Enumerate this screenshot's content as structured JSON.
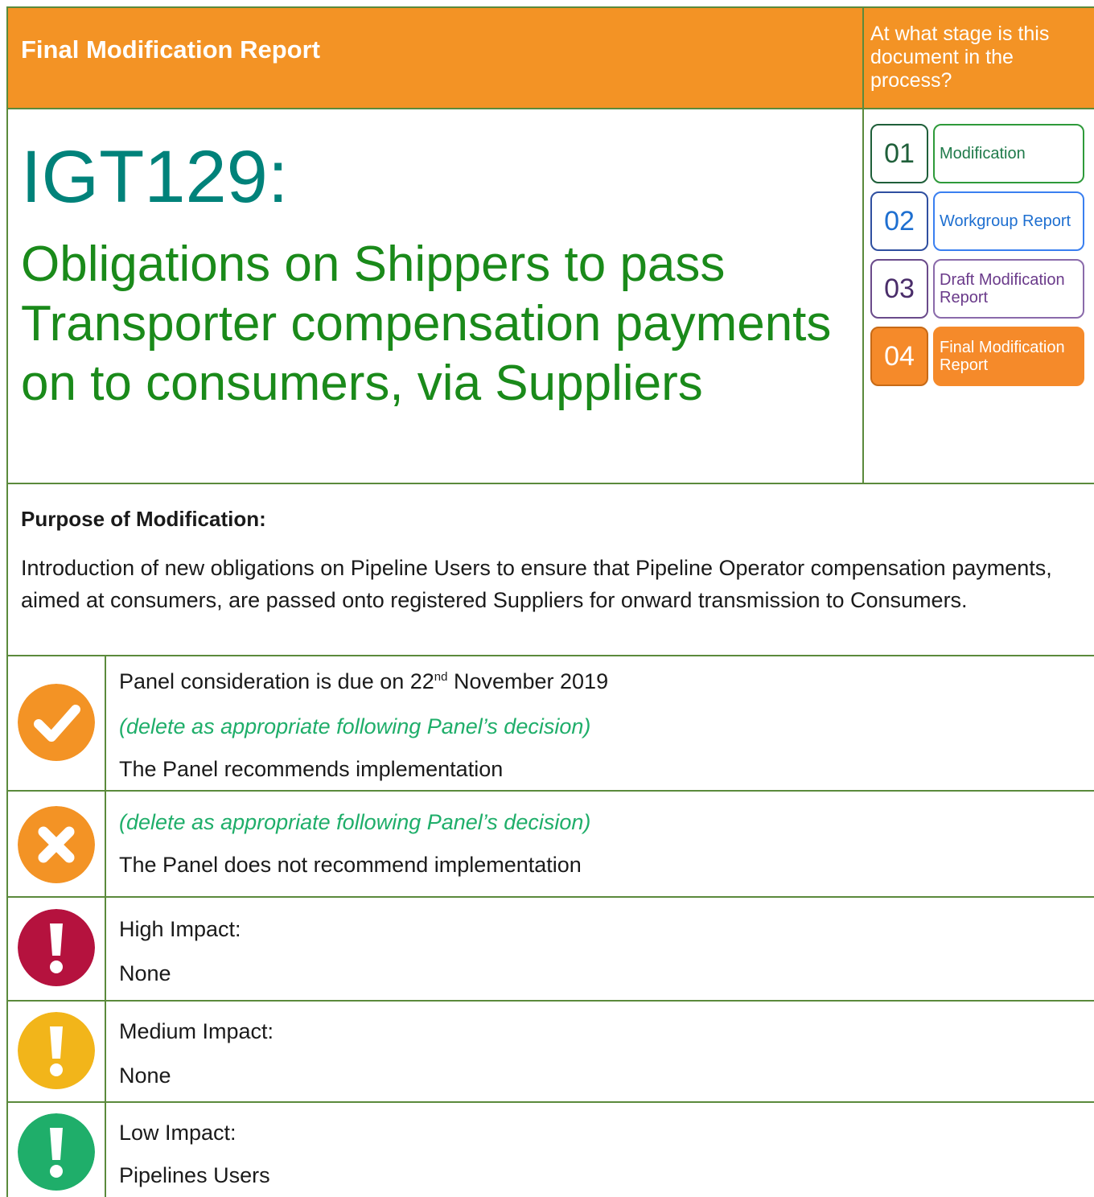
{
  "header": {
    "title": "Final Modification Report",
    "stage_question": "At what stage is this document in the process?"
  },
  "stages": [
    {
      "number": "01",
      "label": "Modification",
      "state": "complete"
    },
    {
      "number": "02",
      "label": "Workgroup Report",
      "state": "complete"
    },
    {
      "number": "03",
      "label": "Draft Modification Report",
      "state": "complete"
    },
    {
      "number": "04",
      "label": "Final Modification Report",
      "state": "current"
    }
  ],
  "modification": {
    "id": "IGT129:",
    "title": "Obligations on Shippers to pass Transporter compensation payments on to consumers, via Suppliers"
  },
  "purpose": {
    "heading": "Purpose of Modification:",
    "text": "Introduction of new obligations on Pipeline Users to ensure that Pipeline Operator compensation payments, aimed at consumers, are passed onto registered Suppliers for onward transmission to Consumers."
  },
  "recommend": {
    "icon": "check-icon",
    "color": "#f39325",
    "line1_pre": "Panel consideration is due on 22",
    "line1_sup": "nd",
    "line1_post": " November 2019",
    "note": "(delete as appropriate following Panel’s decision)",
    "statement": "The Panel recommends implementation"
  },
  "not_recommend": {
    "icon": "cross-icon",
    "color": "#f39325",
    "note": "(delete as appropriate following Panel’s decision)",
    "statement": "The Panel does not recommend implementation"
  },
  "impacts": [
    {
      "level": "High Impact:",
      "value": "None",
      "icon": "exclamation-icon",
      "color": "#b5123e"
    },
    {
      "level": "Medium Impact:",
      "value": "None",
      "icon": "exclamation-icon",
      "color": "#f2b51a"
    },
    {
      "level": "Low Impact:",
      "value": "Pipelines Users",
      "icon": "exclamation-icon",
      "color": "#1fae6a"
    }
  ],
  "colors": {
    "header_orange": "#f39325",
    "border_green": "#5b8a3c",
    "id_teal": "#00827a",
    "title_green": "#1a8a1a",
    "note_green": "#1fae6a"
  }
}
